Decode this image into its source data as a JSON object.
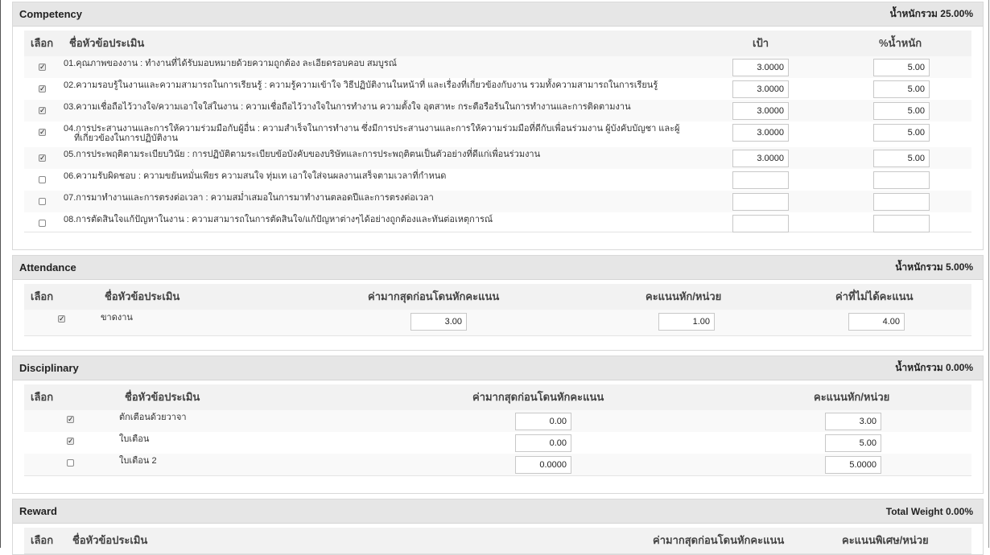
{
  "competency": {
    "title": "Competency",
    "weight": "น้ำหนักรวม 25.00%",
    "col_select": "เลือก",
    "col_name": "ชื่อหัวข้อประเมิน",
    "col_target": "เป้า",
    "col_pct": "%น้ำหนัก",
    "items": [
      {
        "checked": true,
        "label": "01.คุณภาพของงาน : ทำงานที่ได้รับมอบหมายด้วยความถูกต้อง ละเอียดรอบคอบ สมบูรณ์",
        "target": "3.0000",
        "pct": "5.00"
      },
      {
        "checked": true,
        "label": "02.ความรอบรู้ในงานและความสามารถในการเรียนรู้ : ความรู้ความเข้าใจ วิธีปฏิบัติงานในหน้าที่ และเรื่องที่เกี่ยวข้องกับงาน รวมทั้งความสามารถในการเรียนรู้",
        "target": "3.0000",
        "pct": "5.00"
      },
      {
        "checked": true,
        "label": "03.ความเชื่อถือไว้วางใจ/ความเอาใจใส่ในงาน : ความเชื่อถือไว้วางใจในการทำงาน ความตั้งใจ อุตสาหะ กระตือรือร้นในการทำงานและการติดตามงาน",
        "target": "3.0000",
        "pct": "5.00"
      },
      {
        "checked": true,
        "label": "04.การประสานงานและการให้ความร่วมมือกับผู้อื่น : ความสำเร็จในการทำงาน ซึ่งมีการประสานงานและการให้ความร่วมมือที่ดีกับเพื่อนร่วมงาน ผู้บังคับบัญชา และผู้",
        "label2": "ที่เกี่ยวข้องในการปฏิบัติงาน",
        "target": "3.0000",
        "pct": "5.00"
      },
      {
        "checked": true,
        "label": "05.การประพฤติตามระเบียบวินัย : การปฏิบัติตามระเบียบข้อบังคับของบริษัทและการประพฤติตนเป็นตัวอย่างที่ดีแก่เพื่อนร่วมงาน",
        "target": "3.0000",
        "pct": "5.00"
      },
      {
        "checked": false,
        "label": "06.ความรับผิดชอบ : ความขยันหมั่นเพียร ความสนใจ ทุ่มเท เอาใจใส่จนผลงานเสร็จตามเวลาที่กำหนด",
        "target": "",
        "pct": ""
      },
      {
        "checked": false,
        "label": "07.การมาทำงานและการตรงต่อเวลา : ความสม่ำเสมอในการมาทำงานตลอดปีและการตรงต่อเวลา",
        "target": "",
        "pct": ""
      },
      {
        "checked": false,
        "label": "08.การตัดสินใจแก้ปัญหาในงาน : ความสามารถในการตัดสินใจ/แก้ปัญหาต่างๆได้อย่างถูกต้องและทันต่อเหตุการณ์",
        "target": "",
        "pct": ""
      }
    ]
  },
  "attendance": {
    "title": "Attendance",
    "weight": "น้ำหนักรวม 5.00%",
    "col_select": "เลือก",
    "col_name": "ชื่อหัวข้อประเมิน",
    "col_max": "ค่ามากสุดก่อนโดนหักคะแนน",
    "col_deduct": "คะแนนหัก/หน่วย",
    "col_none": "ค่าที่ไม่ได้คะแนน",
    "items": [
      {
        "checked": true,
        "label": "ขาดงาน",
        "max": "3.00",
        "deduct": "1.00",
        "none": "4.00"
      }
    ]
  },
  "disciplinary": {
    "title": "Disciplinary",
    "weight": "น้ำหนักรวม 0.00%",
    "col_select": "เลือก",
    "col_name": "ชื่อหัวข้อประเมิน",
    "col_max": "ค่ามากสุดก่อนโดนหักคะแนน",
    "col_deduct": "คะแนนหัก/หน่วย",
    "items": [
      {
        "checked": true,
        "label": "ตักเตือนด้วยวาจา",
        "max": "0.00",
        "deduct": "3.00"
      },
      {
        "checked": true,
        "label": "ใบเตือน",
        "max": "0.00",
        "deduct": "5.00"
      },
      {
        "checked": false,
        "label": "ใบเตือน 2",
        "max": "0.0000",
        "deduct": "5.0000"
      }
    ]
  },
  "reward": {
    "title": "Reward",
    "weight": "Total Weight 0.00%",
    "col_select": "เลือก",
    "col_name": "ชื่อหัวข้อประเมิน",
    "col_max": "ค่ามากสุดก่อนโดนหักคะแนน",
    "col_bonus": "คะแนนพิเศษ/หน่วย"
  },
  "checkmark": "✓"
}
